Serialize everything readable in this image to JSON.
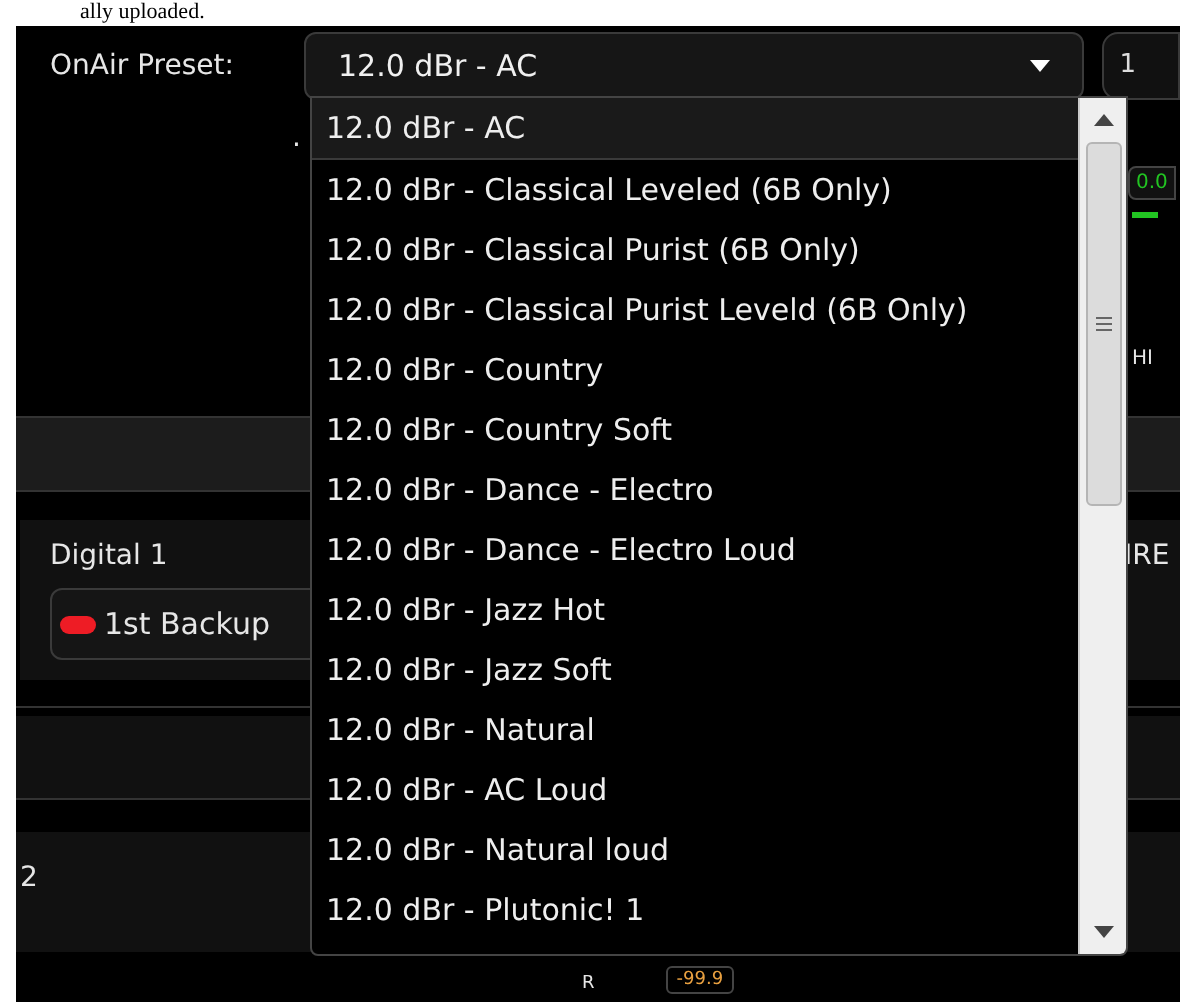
{
  "page_note": "ally uploaded.",
  "preset": {
    "label": "OnAir Preset:",
    "value": "12.0 dBr - AC",
    "side_button": "1"
  },
  "dropdown": {
    "options": [
      {
        "label": "12.0 dBr - AC",
        "selected": true
      },
      {
        "label": "12.0 dBr - Classical Leveled (6B Only)",
        "selected": false
      },
      {
        "label": "12.0 dBr - Classical Purist (6B Only)",
        "selected": false
      },
      {
        "label": "12.0 dBr - Classical Purist Leveld (6B Only)",
        "selected": false
      },
      {
        "label": "12.0 dBr - Country",
        "selected": false
      },
      {
        "label": "12.0 dBr - Country Soft",
        "selected": false
      },
      {
        "label": "12.0 dBr - Dance - Electro",
        "selected": false
      },
      {
        "label": "12.0 dBr - Dance - Electro Loud",
        "selected": false
      },
      {
        "label": "12.0 dBr - Jazz Hot",
        "selected": false
      },
      {
        "label": "12.0 dBr - Jazz Soft",
        "selected": false
      },
      {
        "label": "12.0 dBr - Natural",
        "selected": false
      },
      {
        "label": "12.0 dBr - AC Loud",
        "selected": false
      },
      {
        "label": "12.0 dBr - Natural loud",
        "selected": false
      },
      {
        "label": "12.0 dBr - Plutonic! 1",
        "selected": false
      }
    ]
  },
  "background": {
    "dot": ".",
    "readout": "0.0",
    "hi_label": "HI",
    "input_label": "Digital 1",
    "backup_button": "1st Backup",
    "ire_label": "IRE",
    "channel": "2",
    "r_label": "R",
    "r_readout": "-99.9"
  }
}
